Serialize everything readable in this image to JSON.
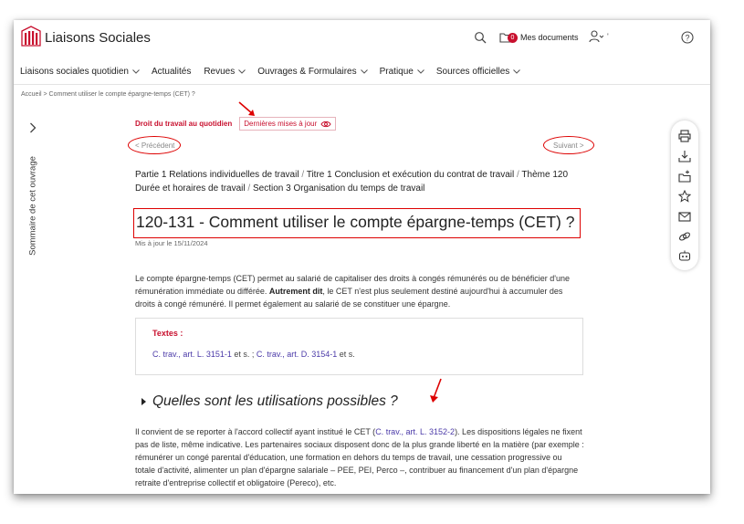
{
  "header": {
    "brand": "Liaisons Sociales",
    "docs_count": "0",
    "docs_label": "Mes documents",
    "user_name": "'"
  },
  "nav": [
    {
      "label": "Liaisons sociales quotidien",
      "dropdown": true
    },
    {
      "label": "Actualités",
      "dropdown": false
    },
    {
      "label": "Revues",
      "dropdown": true
    },
    {
      "label": "Ouvrages & Formulaires",
      "dropdown": true
    },
    {
      "label": "Pratique",
      "dropdown": true
    },
    {
      "label": "Sources officielles",
      "dropdown": true
    }
  ],
  "breadcrumb": "Accueil > Comment utiliser le compte épargne-temps (CET) ?",
  "summary_label": "Sommaire de cet ouvrage",
  "article": {
    "rubrique": "Droit du travail au quotidien",
    "updates_label": "Dernières mises à jour",
    "prev": "< Précédent",
    "next": "Suivant >",
    "path": {
      "part": "Partie 1 Relations individuelles de travail",
      "title": "Titre 1 Conclusion et exécution du contrat de travail",
      "theme": "Thème 120 Durée et horaires de travail",
      "section": "Section 3 Organisation du temps de travail",
      "sep": "/"
    },
    "title": "120-131 - Comment utiliser le compte épargne-temps (CET) ?",
    "updated": "Mis à jour le 15/11/2024",
    "intro_1": "Le compte épargne-temps (CET) permet au salarié de capitaliser des droits à congés rémunérés ou de bénéficier d'une rémunération immédiate ou différée. ",
    "intro_bold": "Autrement dit",
    "intro_2": ", le CET n'est plus seulement destiné aujourd'hui à accumuler des droits à congé rémunéré. Il permet également au salarié de se constituer une épargne.",
    "textes_label": "Textes :",
    "ref_1": "C. trav., art. L. 3151-1",
    "ref_sep": " et s. ; ",
    "ref_2": "C. trav., art. D. 3154-1",
    "ref_end": " et s.",
    "section_title": "Quelles sont les utilisations possibles ?",
    "body_1": "Il convient de se reporter à l'accord collectif ayant institué le CET (",
    "body_ref": "C. trav., art. L. 3152-2",
    "body_2": "). Les dispositions légales ne fixent pas de liste, même indicative. Les partenaires sociaux disposent donc de la plus grande liberté en la matière (par exemple : rémunérer un congé parental d'éducation, une formation en dehors du temps de travail, une cessation progressive ou totale d'activité, alimenter un plan d'épargne salariale – PEE, PEI, Perco –, contribuer au financement d'un plan d'épargne retraite d'entreprise collectif et obligatoire (Pereco), etc."
  },
  "colors": {
    "accent": "#c8102e",
    "link": "#4b3aa8",
    "annotation": "#dd0000"
  },
  "tools": [
    "print-icon",
    "download-icon",
    "add-folder-icon",
    "star-icon",
    "mail-icon",
    "link-icon",
    "robot-icon"
  ]
}
